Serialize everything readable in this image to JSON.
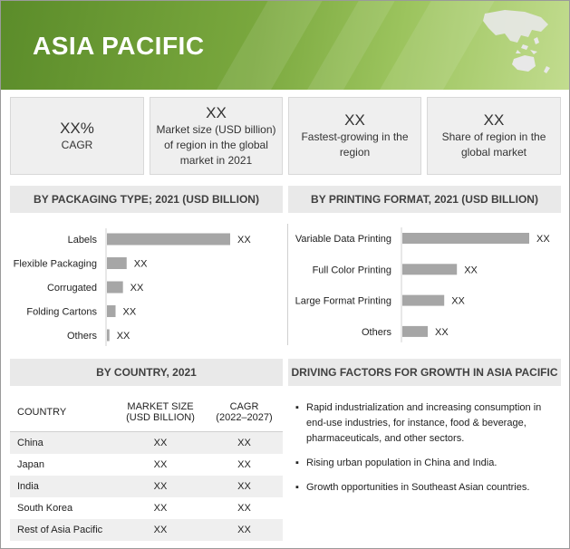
{
  "header": {
    "title": "ASIA PACIFIC"
  },
  "kpis": [
    {
      "value": "XX%",
      "label": "CAGR"
    },
    {
      "value": "XX",
      "label": "Market size (USD billion) of region in the global market in 2021"
    },
    {
      "value": "XX",
      "label": "Fastest-growing in the region"
    },
    {
      "value": "XX",
      "label": "Share of region in the global market"
    }
  ],
  "sections": {
    "packaging": "BY PACKAGING TYPE; 2021 (USD BILLION)",
    "printing": "BY PRINTING FORMAT, 2021 (USD BILLION)",
    "country": "BY COUNTRY, 2021",
    "drivers": "DRIVING FACTORS FOR GROWTH IN ASIA PACIFIC"
  },
  "chart_data": [
    {
      "type": "bar",
      "orientation": "horizontal",
      "title": "BY PACKAGING TYPE; 2021 (USD BILLION)",
      "categories": [
        "Labels",
        "Flexible Packaging",
        "Corrugated",
        "Folding Cartons",
        "Others"
      ],
      "values": [
        100,
        16,
        13,
        7,
        2
      ],
      "data_labels": [
        "XX",
        "XX",
        "XX",
        "XX",
        "XX"
      ],
      "bar_color": "#a6a6a6"
    },
    {
      "type": "bar",
      "orientation": "horizontal",
      "title": "BY PRINTING FORMAT, 2021 (USD BILLION)",
      "categories": [
        "Variable Data Printing",
        "Full Color Printing",
        "Large Format Printing",
        "Others"
      ],
      "values": [
        100,
        43,
        33,
        20
      ],
      "data_labels": [
        "XX",
        "XX",
        "XX",
        "XX"
      ],
      "bar_color": "#a6a6a6"
    }
  ],
  "country_table": {
    "headers": [
      "COUNTRY",
      "MARKET SIZE (USD BILLION)",
      "CAGR (2022–2027)"
    ],
    "header_lines": [
      [
        "COUNTRY"
      ],
      [
        "MARKET SIZE",
        "(USD BILLION)"
      ],
      [
        "CAGR",
        "(2022–2027)"
      ]
    ],
    "rows": [
      [
        "China",
        "XX",
        "XX"
      ],
      [
        "Japan",
        "XX",
        "XX"
      ],
      [
        "India",
        "XX",
        "XX"
      ],
      [
        "South Korea",
        "XX",
        "XX"
      ],
      [
        "Rest of Asia Pacific",
        "XX",
        "XX"
      ]
    ]
  },
  "drivers": [
    "Rapid industrialization and increasing consumption in end-use industries, for instance, food & beverage, pharmaceuticals, and other sectors.",
    "Rising urban population in China and India.",
    "Growth opportunities in Southeast Asian countries."
  ],
  "colors": {
    "banner_dark": "#5b8c2a",
    "banner_light": "#c2dc8f",
    "panel_bg": "#efefef",
    "bar": "#a6a6a6"
  }
}
